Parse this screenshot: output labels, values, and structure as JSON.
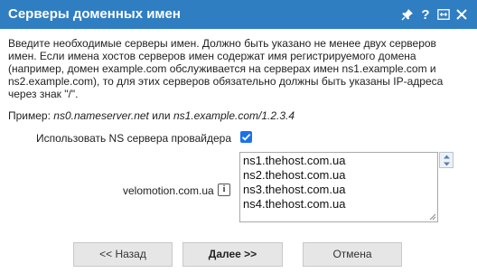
{
  "dialog": {
    "title": "Серверы доменных имен",
    "icons": [
      "pin-icon",
      "help-icon",
      "maximize-icon",
      "close-icon"
    ]
  },
  "description": "Введите необходимые серверы имен. Должно быть указано не менее двух серверов имен. Если имена хостов серверов имен содержат имя регистрируемого домена (например, домен example.com обслуживается на серверах имен ns1.example.com и ns2.example.com), то для этих серверов обязательно должны быть указаны IP-адреса через знак \"/\".",
  "example": {
    "prefix": "Пример: ",
    "sample1": "ns0.nameserver.net",
    "or": " или ",
    "sample2": "ns1.example.com/1.2.3.4"
  },
  "use_provider_ns": {
    "label": "Использовать NS сервера провайдера",
    "checked": true
  },
  "domain": {
    "label": "velomotion.com.ua",
    "info_icon": "i",
    "nameservers": [
      "ns1.thehost.com.ua",
      "ns2.thehost.com.ua",
      "ns3.thehost.com.ua",
      "ns4.thehost.com.ua"
    ]
  },
  "buttons": {
    "back": "<< Назад",
    "next": "Далее >>",
    "cancel": "Отмена"
  },
  "colors": {
    "titlebar": "#2f7ec2",
    "checkbox": "#1a73e8",
    "button_bg": "#e6e6e6"
  }
}
